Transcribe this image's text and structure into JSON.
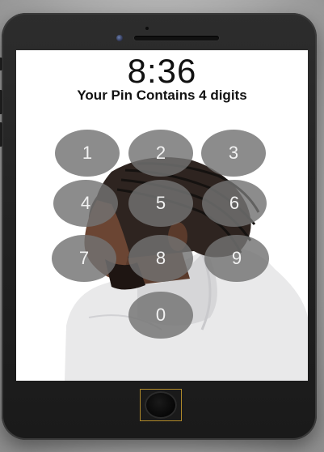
{
  "lock_screen": {
    "time": "8:36",
    "hint": "Your Pin Contains 4 digits"
  },
  "keypad": {
    "keys": [
      "1",
      "2",
      "3",
      "4",
      "5",
      "6",
      "7",
      "8",
      "9",
      "0"
    ]
  },
  "icons": {
    "front_camera": "camera-icon",
    "speaker": "speaker-grille",
    "home_button": "home-button"
  }
}
